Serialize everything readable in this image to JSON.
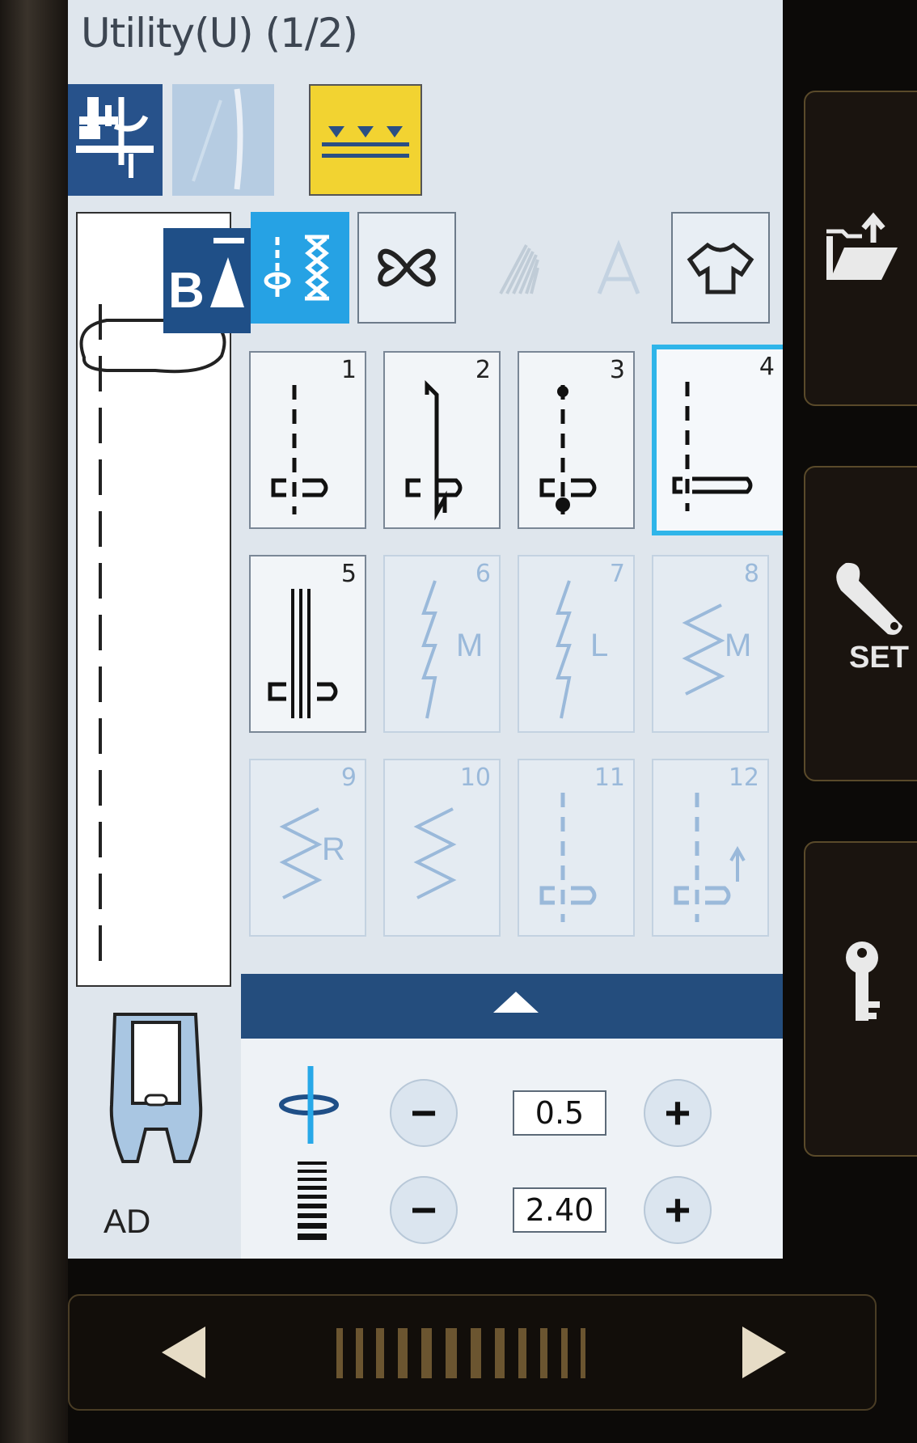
{
  "screen": {
    "title": "Utility(U) (1/2)"
  },
  "modes": [
    {
      "name": "presser-foot-mode",
      "state": "active"
    },
    {
      "name": "needle-mode",
      "state": "disabled"
    },
    {
      "name": "feed-dog-mode",
      "state": "highlighted"
    }
  ],
  "preview": {
    "lock_icon": "b-triangle-lock-icon",
    "foot_label": "AD"
  },
  "categories": [
    {
      "icon": "utility-stitch-icon",
      "state": "active"
    },
    {
      "icon": "decorative-stitch-icon",
      "state": "normal"
    },
    {
      "icon": "satin-stitch-icon",
      "state": "disabled"
    },
    {
      "icon": "letter-a-icon",
      "state": "disabled"
    },
    {
      "icon": "shirt-icon",
      "state": "normal"
    }
  ],
  "stitches": [
    {
      "number": "1",
      "state": "normal"
    },
    {
      "number": "2",
      "state": "normal"
    },
    {
      "number": "3",
      "state": "normal"
    },
    {
      "number": "4",
      "state": "selected"
    },
    {
      "number": "5",
      "state": "normal"
    },
    {
      "number": "6",
      "label": "M",
      "state": "disabled"
    },
    {
      "number": "7",
      "label": "L",
      "state": "disabled"
    },
    {
      "number": "8",
      "label": "M",
      "state": "disabled"
    },
    {
      "number": "9",
      "label": "R",
      "state": "disabled"
    },
    {
      "number": "10",
      "state": "disabled"
    },
    {
      "number": "11",
      "state": "disabled"
    },
    {
      "number": "12",
      "state": "disabled"
    }
  ],
  "settings": {
    "needle_position": {
      "value": "0.5",
      "minus": "−",
      "plus": "+"
    },
    "stitch_length": {
      "value": "2.40",
      "minus": "−",
      "plus": "+"
    }
  },
  "side_buttons": [
    {
      "icon": "folder-export-icon"
    },
    {
      "icon": "wrench-icon",
      "label": "SET"
    },
    {
      "icon": "key-icon"
    }
  ],
  "slider": {
    "left_icon": "triangle-left-icon",
    "right_icon": "triangle-right-icon"
  },
  "colors": {
    "screen_bg": "#dfe6ed",
    "accent_blue": "#26a2e4",
    "dark_blue": "#244d7d",
    "selected_border": "#2fb5e9",
    "feed_dog_yellow": "#f2d331",
    "disabled_stitch": "#9ab9da",
    "bezel": "#0c0a08",
    "bezel_trim": "#5a4a2a"
  }
}
